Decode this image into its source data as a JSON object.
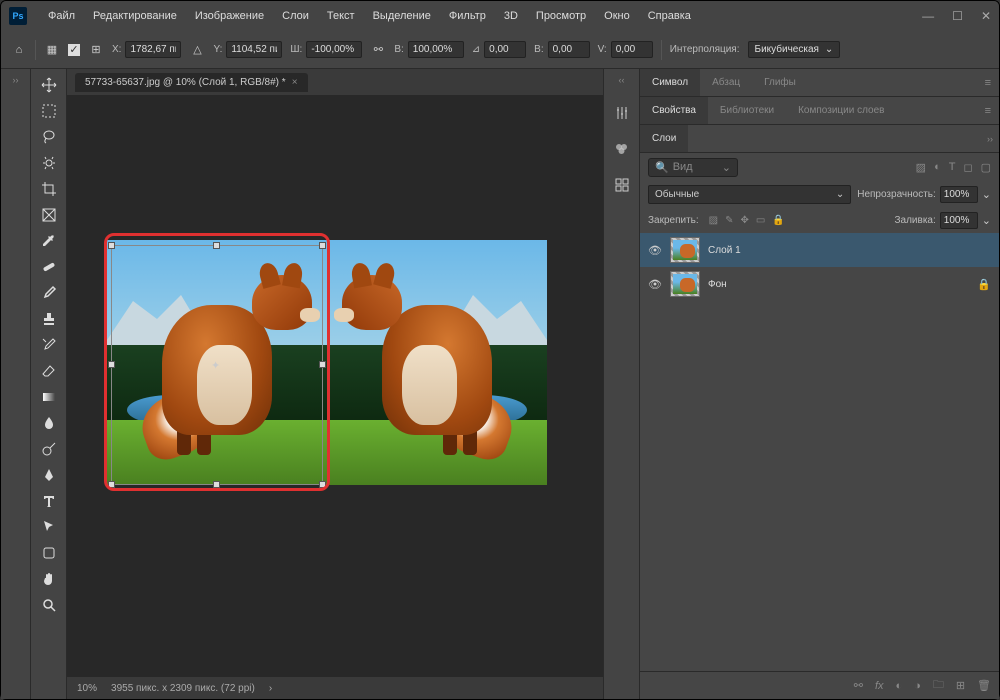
{
  "titlebar": {
    "logo": "Ps"
  },
  "menu": [
    "Файл",
    "Редактирование",
    "Изображение",
    "Слои",
    "Текст",
    "Выделение",
    "Фильтр",
    "3D",
    "Просмотр",
    "Окно",
    "Справка"
  ],
  "options": {
    "x_label": "X:",
    "x": "1782,67 пи",
    "y_label": "Y:",
    "y": "1104,52 пи",
    "w_label": "Ш:",
    "w": "-100,00%",
    "h_label": "В:",
    "h": "100,00%",
    "angle_label": "⊿",
    "angle": "0,00",
    "skew_h_label": "В:",
    "skew_h": "0,00",
    "skew_v_label": "V:",
    "skew_v": "0,00",
    "interp_label": "Интерполяция:",
    "interp_value": "Бикубическая"
  },
  "doc_tab": {
    "title": "57733-65637.jpg @ 10% (Слой 1, RGB/8#) *"
  },
  "statusbar": {
    "zoom": "10%",
    "info": "3955 пикс. x 2309 пикс. (72 ppi)"
  },
  "panel_group1": {
    "tabs": [
      "Символ",
      "Абзац",
      "Глифы"
    ],
    "active": 0
  },
  "panel_group2": {
    "tabs": [
      "Свойства",
      "Библиотеки",
      "Композиции слоев"
    ],
    "active": 0
  },
  "panel_group3": {
    "tabs": [
      "Слои"
    ],
    "active": 0
  },
  "layers": {
    "search_placeholder": "Вид",
    "blend_mode": "Обычные",
    "opacity_label": "Непрозрачность:",
    "opacity": "100%",
    "lock_label": "Закрепить:",
    "fill_label": "Заливка:",
    "fill": "100%",
    "items": [
      {
        "name": "Слой 1",
        "selected": true,
        "locked": false
      },
      {
        "name": "Фон",
        "selected": false,
        "locked": true
      }
    ]
  },
  "chart_data": null
}
